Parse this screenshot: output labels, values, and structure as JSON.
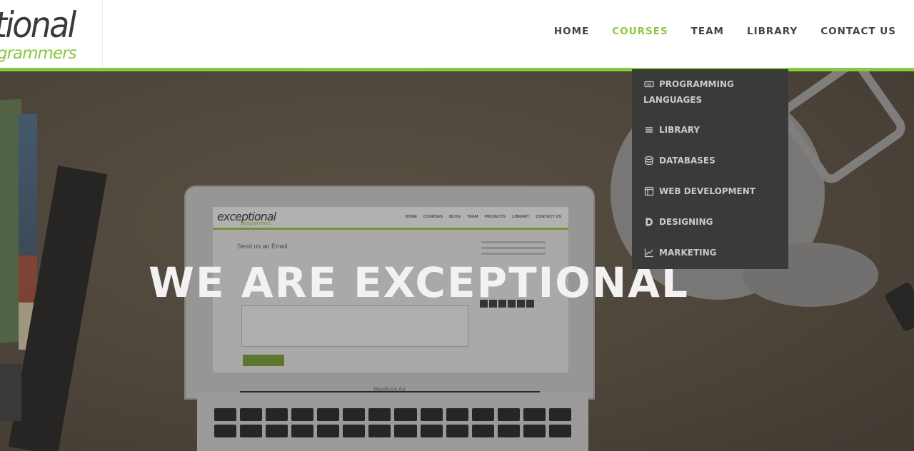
{
  "logo": {
    "line1": "tional",
    "line2": "grammers"
  },
  "nav": {
    "items": [
      {
        "label": "HOME",
        "active": false
      },
      {
        "label": "COURSES",
        "active": true
      },
      {
        "label": "TEAM",
        "active": false
      },
      {
        "label": "LIBRARY",
        "active": false
      },
      {
        "label": "CONTACT US",
        "active": false
      }
    ]
  },
  "colors": {
    "accent": "#8dc63f",
    "dropdown_bg": "#3a3a3a",
    "nav_text": "#444444"
  },
  "courses_dropdown": {
    "items": [
      {
        "label": "PROGRAMMING LANGUAGES",
        "icon": "keyboard-icon"
      },
      {
        "label": "LIBRARY",
        "icon": "list-icon"
      },
      {
        "label": "DATABASES",
        "icon": "database-icon"
      },
      {
        "label": "WEB DEVELOPMENT",
        "icon": "layout-icon"
      },
      {
        "label": "DESIGNING",
        "icon": "d-letter-icon"
      },
      {
        "label": "MARKETING",
        "icon": "chart-line-icon"
      }
    ]
  },
  "hero": {
    "title": "WE ARE EXCEPTIONAL"
  },
  "laptop_screen": {
    "logo": "exceptional",
    "logo_sub": "programmers",
    "nav": [
      "HOME",
      "COURSES",
      "BLOG",
      "TEAM",
      "PROJECTS",
      "LIBRARY",
      "CONTACT US"
    ],
    "form_title": "Send us an Email",
    "brand": "MacBook Air"
  }
}
